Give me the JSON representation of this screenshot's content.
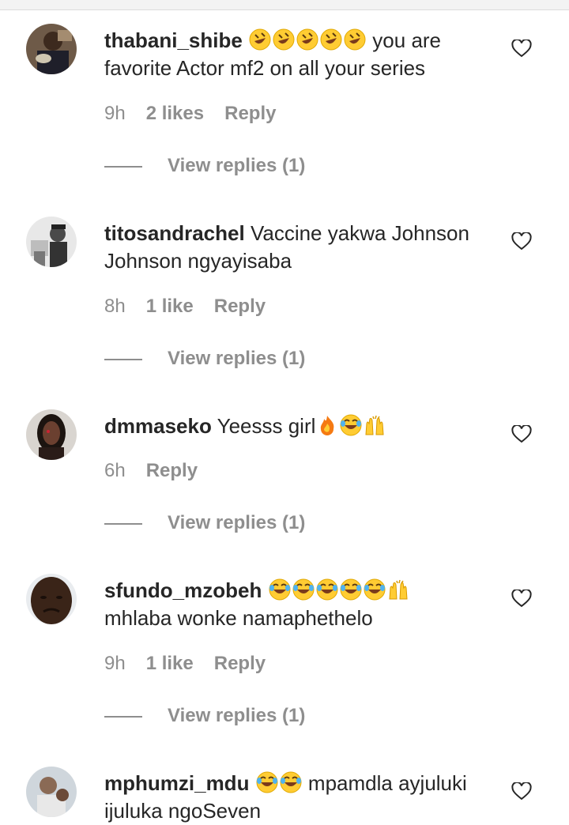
{
  "comments": [
    {
      "username": "thabani_shibe",
      "text_before": "",
      "emoji": [
        "rofl",
        "rofl",
        "rofl",
        "rofl",
        "rofl"
      ],
      "text": "you are favorite Actor mf2 on all your series",
      "time": "9h",
      "likes": "2 likes",
      "reply": "Reply",
      "view_replies": "View replies (1)"
    },
    {
      "username": "titosandrachel",
      "emoji": [],
      "text": "Vaccine yakwa Johnson Johnson ngyayisaba",
      "time": "8h",
      "likes": "1 like",
      "reply": "Reply",
      "view_replies": "View replies (1)"
    },
    {
      "username": "dmmaseko",
      "text_before": "Yeesss girl",
      "emoji": [
        "fire",
        "joy",
        "raised-hands"
      ],
      "text": "",
      "time": "6h",
      "likes": "",
      "reply": "Reply",
      "view_replies": "View replies (1)"
    },
    {
      "username": "sfundo_mzobeh",
      "emoji": [
        "joy",
        "joy",
        "joy",
        "joy",
        "joy",
        "raised-hands"
      ],
      "text": "mhlaba wonke namaphethelo",
      "time": "9h",
      "likes": "1 like",
      "reply": "Reply",
      "view_replies": "View replies (1)"
    },
    {
      "username": "mphumzi_mdu",
      "emoji": [
        "joy",
        "joy"
      ],
      "text": "mpamdla ayjuluki ijuluka ngoSeven",
      "time": "",
      "likes": "",
      "reply": "",
      "view_replies": ""
    }
  ],
  "icons": {
    "like": "heart-outline-icon",
    "avatar": "avatar"
  },
  "colors": {
    "text": "#262626",
    "secondary": "#8e8e8e",
    "emoji_face": "#ffcc33"
  }
}
